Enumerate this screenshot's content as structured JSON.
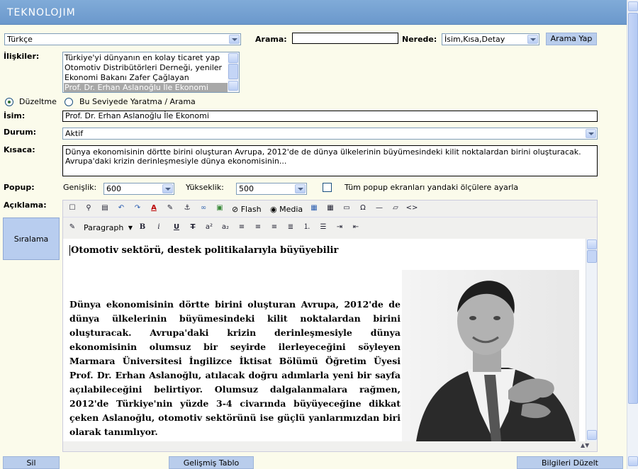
{
  "app": {
    "title": "TEKNOLOJIM"
  },
  "language": {
    "value": "Türkçe"
  },
  "search": {
    "label": "Arama:",
    "value": "",
    "where_label": "Nerede:",
    "where_value": "İsim,Kısa,Detay",
    "button": "Arama Yap"
  },
  "relations": {
    "label": "İlişkiler:",
    "items": [
      "Türkiye'yi dünyanın en kolay ticaret yap",
      "Otomotiv Distribütörleri Derneği, yeniler",
      "Ekonomi Bakanı Zafer Çağlayan",
      "Prof. Dr. Erhan Aslanoğlu İle Ekonomi"
    ],
    "selected_index": 3
  },
  "mode": {
    "edit_label": "Düzeltme",
    "create_label": "Bu Seviyede Yaratma / Arama",
    "selected": "edit"
  },
  "name": {
    "label": "İsim:",
    "value": "Prof. Dr. Erhan Aslanoğlu İle Ekonomi"
  },
  "status": {
    "label": "Durum:",
    "value": "Aktif"
  },
  "summary": {
    "label": "Kısaca:",
    "value": "Dünya ekonomisinin dörtte birini oluşturan Avrupa, 2012'de de dünya ülkelerinin büyümesindeki kilit noktalardan birini oluşturacak. Avrupa'daki krizin derinleşmesiyle dünya ekonomisinin..."
  },
  "popup": {
    "label": "Popup:",
    "width_label": "Genişlik:",
    "width_value": "600",
    "height_label": "Yükseklik:",
    "height_value": "500",
    "all_label": "Tüm popup ekranları yandaki ölçülere ayarla",
    "all_checked": false
  },
  "description": {
    "label": "Açıklama:"
  },
  "sort_button": "Sıralama",
  "editor": {
    "toolbar1": {
      "flash": "Flash",
      "media": "Media"
    },
    "format_value": "Paragraph",
    "heading": "Otomotiv sektörü, destek politikalarıyla büyüyebilir",
    "body": "Dünya ekonomisinin dörtte birini oluşturan Avrupa, 2012'de de dünya ülkelerinin büyümesindeki kilit noktalardan birini oluşturacak. Avrupa'daki krizin derinleşmesiyle dünya ekonomisinin olumsuz bir seyirde ilerleyeceğini söyleyen Marmara Üniversitesi İngilizce İktisat Bölümü Öğretim Üyesi Prof. Dr. Erhan Aslanoğlu, atılacak doğru adımlarla yeni bir sayfa açılabileceğini belirtiyor. Olumsuz dalgalanmalara rağmen, 2012'de Türkiye'nin yüzde 3-4 civarında büyüyeceğine dikkat çeken Aslanoğlu, otomotiv sektörünü ise güçlü yanlarımızdan biri olarak tanımlıyor."
  },
  "footer": {
    "delete": "Sil",
    "advanced_table": "Gelişmiş Tablo",
    "save": "Bilgileri Düzelt"
  }
}
